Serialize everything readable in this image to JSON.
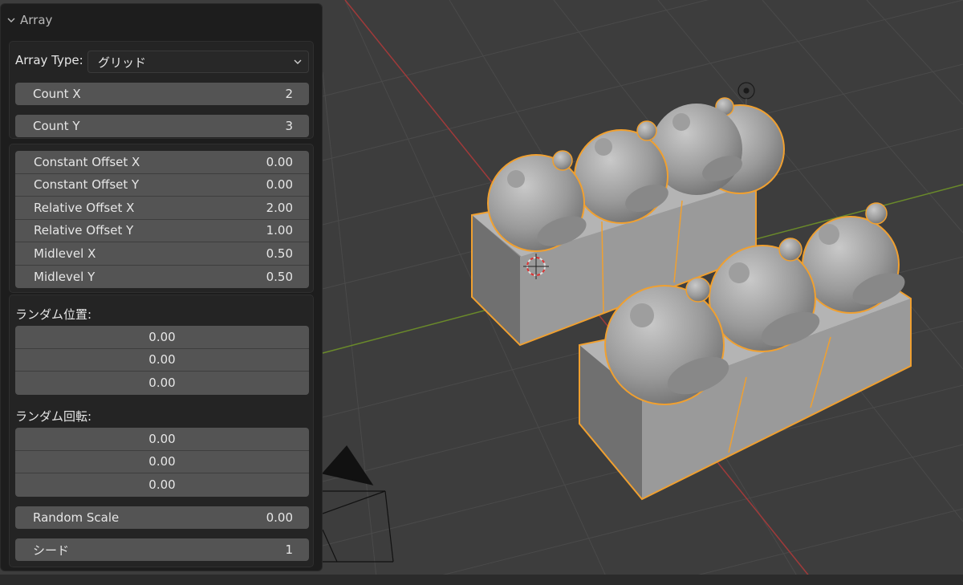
{
  "panel": {
    "title": "Array",
    "array_type_label": "Array Type:",
    "array_type_value": "グリッド",
    "count_x": {
      "label": "Count X",
      "value": "2"
    },
    "count_y": {
      "label": "Count Y",
      "value": "3"
    },
    "offsets": [
      {
        "label": "Constant Offset X",
        "value": "0.00"
      },
      {
        "label": "Constant Offset Y",
        "value": "0.00"
      },
      {
        "label": "Relative Offset X",
        "value": "2.00"
      },
      {
        "label": "Relative Offset Y",
        "value": "1.00"
      },
      {
        "label": "Midlevel X",
        "value": "0.50"
      },
      {
        "label": "Midlevel Y",
        "value": "0.50"
      }
    ],
    "random_location_label": "ランダム位置:",
    "random_location": [
      "0.00",
      "0.00",
      "0.00"
    ],
    "random_rotation_label": "ランダム回転:",
    "random_rotation": [
      "0.00",
      "0.00",
      "0.00"
    ],
    "random_scale": {
      "label": "Random Scale",
      "value": "0.00"
    },
    "seed": {
      "label": "シード",
      "value": "1"
    }
  },
  "colors": {
    "viewport_bg": "#3d3d3d",
    "panel_bg": "#1d1d1d",
    "field_bg": "#545454",
    "selection_outline": "#f0a030",
    "axis_x": "#a03a3a",
    "axis_y": "#6a8a2a"
  }
}
